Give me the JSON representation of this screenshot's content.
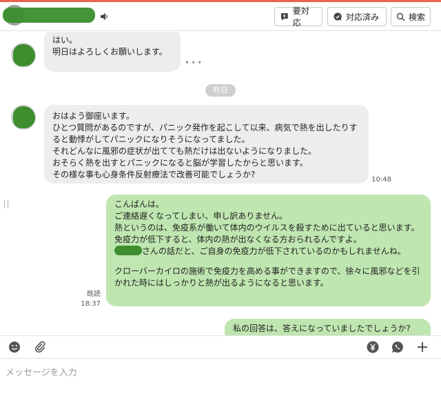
{
  "header": {
    "todo_label": "要対応",
    "done_label": "対応済み",
    "search_label": "検索",
    "speaker_icon": "speaker-icon"
  },
  "timeline": {
    "msg1": "はい。\n明日はよろしくお願いします。",
    "date_separator": "昨日",
    "msg2": "おはよう御座います。\nひとつ質問があるのですが、パニック発作を起こして以来、病気で熱を出したりすると動悸がしてパニックになりそうになってました。\nそれどんなに風邪の症状が出てても熱だけは出ないようになりました。\nおそらく熱を出すとパニックになると脳が学習したからと思います。\nその様な事も心身条件反射療法で改善可能でしょうか?",
    "msg2_time": "10:48",
    "reply": {
      "line1": "こんばんは。",
      "line2": "ご連絡遅くなってしまい、申し訳ありません。",
      "line3": "熱というのは、免疫系が働いて体内のウイルスを殺すために出ていると思います。",
      "line4": "免疫力が低下すると、体内の熱が出なくなる方おられるんですよ。",
      "line5_suffix": "さんの話だと、ご自身の免疫力が低下されているのかもしれませんね。",
      "line6": "クローバーカイロの施術で免疫力を高める事ができますので、徐々に風邪などを引かれた時にはしっかりと熱が出るようになると思います。"
    },
    "reply_read": "既読",
    "reply_time": "18:37",
    "msg4": "私の回答は、答えになっていましたでしょうか?"
  },
  "toolbar": {
    "icons": [
      "emoji-icon",
      "attachment-icon",
      "yen-icon",
      "call-icon",
      "plus-icon"
    ]
  },
  "composer": {
    "placeholder": "メッセージを入力",
    "value": ""
  },
  "colors": {
    "accent": "#e8644a",
    "incoming_bubble": "#ededed",
    "outgoing_bubble": "#bfe6b0"
  }
}
